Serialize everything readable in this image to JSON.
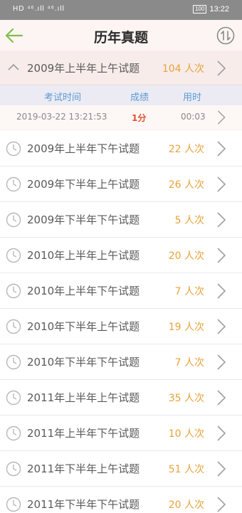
{
  "status_bar": {
    "signal": "HD ⁴⁶.ıll ⁴⁶.ıll",
    "battery": "100",
    "time": "13:22"
  },
  "header": {
    "title": "历年真题"
  },
  "expanded": {
    "name": "2009年上半年上午试题",
    "count": "104 人次",
    "columns": {
      "time": "考试时间",
      "score": "成绩",
      "duration": "用时"
    },
    "record": {
      "time": "2019-03-22 13:21:53",
      "score": "1分",
      "duration": "00:03"
    }
  },
  "exams": [
    {
      "name": "2009年上半年下午试题",
      "count": "22 人次"
    },
    {
      "name": "2009年下半年上午试题",
      "count": "26 人次"
    },
    {
      "name": "2009年下半年下午试题",
      "count": "5 人次"
    },
    {
      "name": "2010年上半年上午试题",
      "count": "20 人次"
    },
    {
      "name": "2010年上半年下午试题",
      "count": "7 人次"
    },
    {
      "name": "2010年下半年上午试题",
      "count": "19 人次"
    },
    {
      "name": "2010年下半年下午试题",
      "count": "7 人次"
    },
    {
      "name": "2011年上半年上午试题",
      "count": "35 人次"
    },
    {
      "name": "2011年上半年下午试题",
      "count": "10 人次"
    },
    {
      "name": "2011年下半年上午试题",
      "count": "51 人次"
    },
    {
      "name": "2011年下半年下午试题",
      "count": "20 人次"
    }
  ],
  "colors": {
    "accent": "#7cc04a",
    "count": "#e8a23b",
    "score": "#e0502b",
    "column_header": "#5b9bd5"
  }
}
